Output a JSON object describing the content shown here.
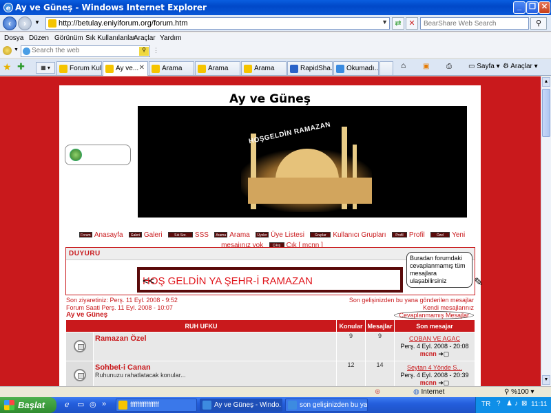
{
  "window": {
    "title": "Ay ve Güneş - Windows Internet Explorer"
  },
  "address": {
    "url": "http://betulay.eniyiforum.org/forum.htm",
    "search_placeholder": "BearShare Web Search"
  },
  "menu": [
    "Dosya",
    "Düzen",
    "Görünüm",
    "Sık Kullanılanlar",
    "Araçlar",
    "Yardım"
  ],
  "toolbar": {
    "search_placeholder": "Search the web"
  },
  "tabs": [
    "Forum Kul...",
    "Ay ve...",
    "Arama",
    "Arama",
    "Arama",
    "RapidSha...",
    "Okumadı..."
  ],
  "commands": {
    "page": "Sayfa",
    "tools": "Araçlar"
  },
  "page": {
    "site_title": "Ay ve Güneş",
    "banner_text": "HOŞGELDİN RAMAZAN",
    "nav": [
      {
        "icon": "Forum",
        "label": "Anasayfa"
      },
      {
        "icon": "Galeri",
        "label": "Galeri"
      },
      {
        "icon": "Sık Sor.",
        "label": "SSS"
      },
      {
        "icon": "Arama",
        "label": "Arama"
      },
      {
        "icon": "Üyeler",
        "label": "Üye Listesi"
      },
      {
        "icon": "Gruplar",
        "label": "Kullanıcı Grupları"
      },
      {
        "icon": "Profil",
        "label": "Profil"
      },
      {
        "icon": "Özel",
        "label": "Yeni mesajınız yok"
      },
      {
        "icon": "Çıkış",
        "label": "Çık [ mcnn ]"
      }
    ],
    "announcement": {
      "header": "DUYURU",
      "marquee": "HOŞ GELDİN YA ŞEHR-İ RAMAZAN",
      "marquee_arrows": "<<",
      "callout": "Buradan forumdaki cevaplanmamış tüm mesajlara ulaşabilirsiniz"
    },
    "stats": {
      "last_visit": "Son ziyaretiniz: Perş. 11 Eyl. 2008 - 9:52",
      "forum_time": "Forum Saati Perş. 11 Eyl. 2008 - 10:07",
      "link_since": "Son gelişinizden bu yana gönderilen mesajlar",
      "link_own": "Kendi mesajlarınız",
      "link_unanswered": "Cevaplanmamış Mesajlar"
    },
    "breadcrumb": "Ay ve Güneş",
    "table": {
      "category": "RUH UFKU",
      "col_topics": "Konular",
      "col_posts": "Mesajlar",
      "col_last": "Son mesajar",
      "rows": [
        {
          "name": "Ramazan Özel",
          "desc": "",
          "topics": "9",
          "posts": "9",
          "last_title": "COBAN VE AGAC",
          "last_date": "Perş. 4 Eyl. 2008 - 20:08",
          "last_user": "mcnn"
        },
        {
          "name": "Sohbet-i Canan",
          "desc": "Ruhunuzu rahatlatacak konular...",
          "topics": "12",
          "posts": "14",
          "last_title": "Seytan 4 Yönde S...",
          "last_date": "Perş. 4 Eyl. 2008 - 20:39",
          "last_user": "mcnn"
        }
      ]
    }
  },
  "status": {
    "zone": "Internet",
    "zoom": "%100"
  },
  "taskbar": {
    "start": "Başlat",
    "items": [
      "ffffffffffffffff",
      "Ay ve Güneş - Windo...",
      "son gelişinizden bu ya..."
    ],
    "lang": "TR",
    "clock": "11:11"
  }
}
